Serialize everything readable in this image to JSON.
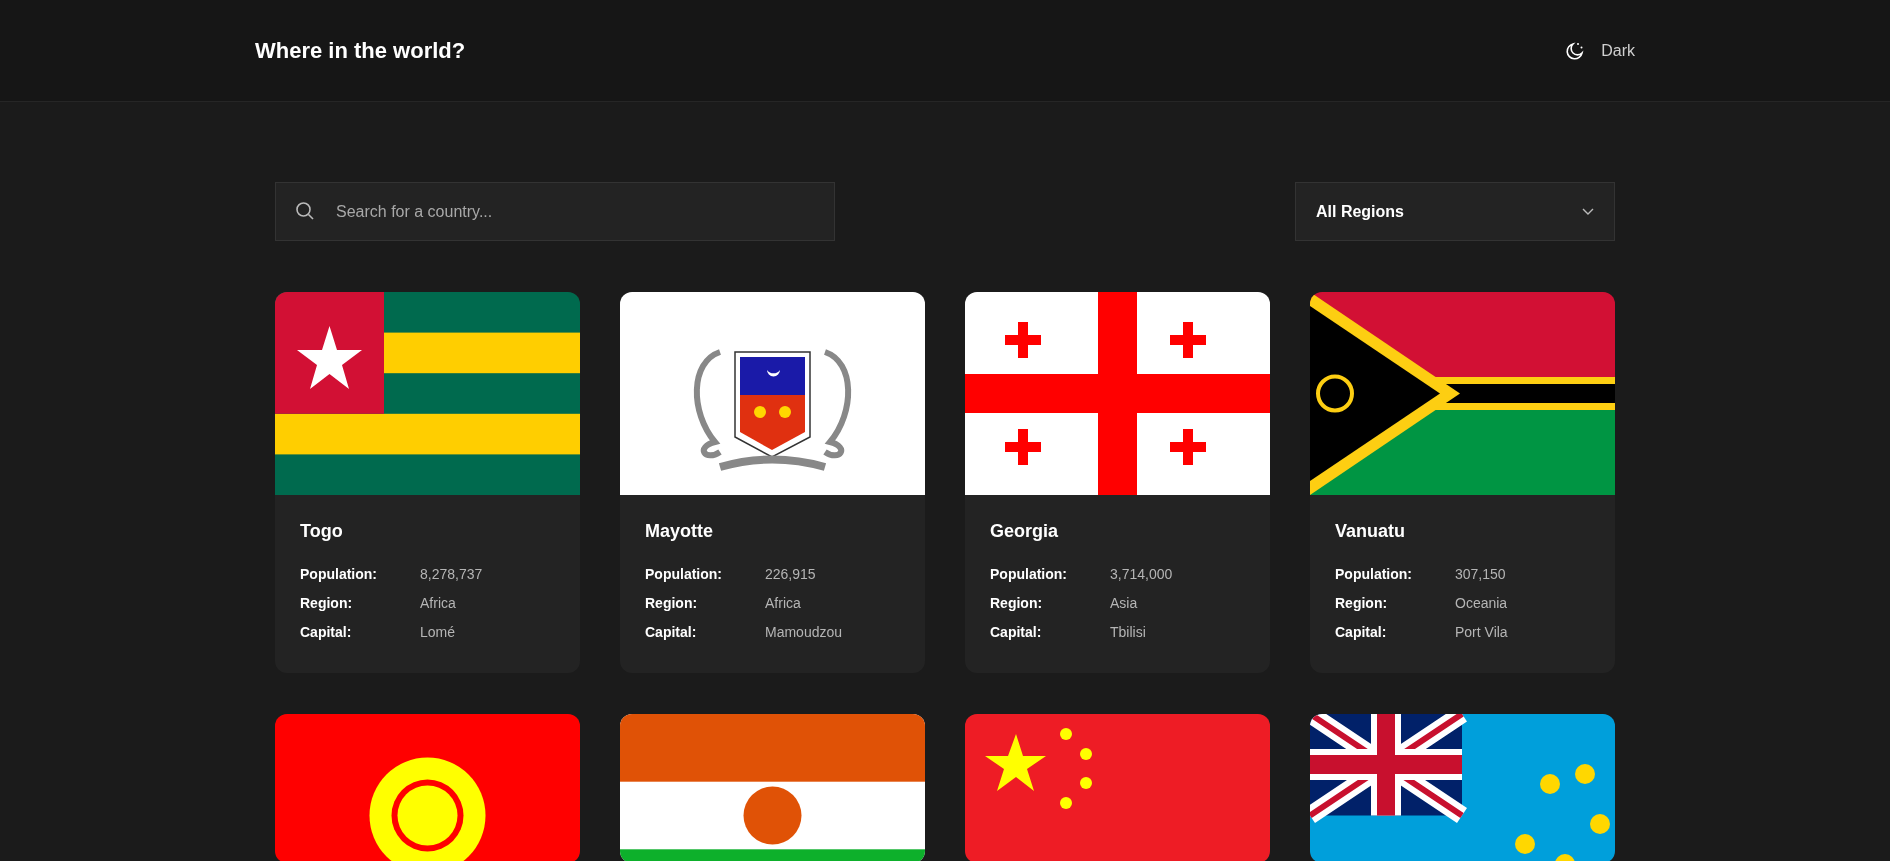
{
  "header": {
    "title": "Where in the world?",
    "theme_toggle": {
      "label": "Dark"
    }
  },
  "search": {
    "placeholder": "Search for a country..."
  },
  "region_filter": {
    "value": "All Regions"
  },
  "countries": [
    {
      "kind": "togo",
      "name": "Togo",
      "details": [
        {
          "label": "Population:",
          "value": "8,278,737"
        },
        {
          "label": "Region:",
          "value": "Africa"
        },
        {
          "label": "Capital:",
          "value": "Lomé"
        }
      ]
    },
    {
      "kind": "mayotte",
      "name": "Mayotte",
      "details": [
        {
          "label": "Population:",
          "value": "226,915"
        },
        {
          "label": "Region:",
          "value": "Africa"
        },
        {
          "label": "Capital:",
          "value": "Mamoudzou"
        }
      ]
    },
    {
      "kind": "georgia",
      "name": "Georgia",
      "details": [
        {
          "label": "Population:",
          "value": "3,714,000"
        },
        {
          "label": "Region:",
          "value": "Asia"
        },
        {
          "label": "Capital:",
          "value": "Tbilisi"
        }
      ]
    },
    {
      "kind": "vanuatu",
      "name": "Vanuatu",
      "details": [
        {
          "label": "Population:",
          "value": "307,150"
        },
        {
          "label": "Region:",
          "value": "Oceania"
        },
        {
          "label": "Capital:",
          "value": "Port Vila"
        }
      ]
    },
    {
      "kind": "kyrgyzstan"
    },
    {
      "kind": "niger"
    },
    {
      "kind": "china"
    },
    {
      "kind": "tuvalu"
    }
  ]
}
